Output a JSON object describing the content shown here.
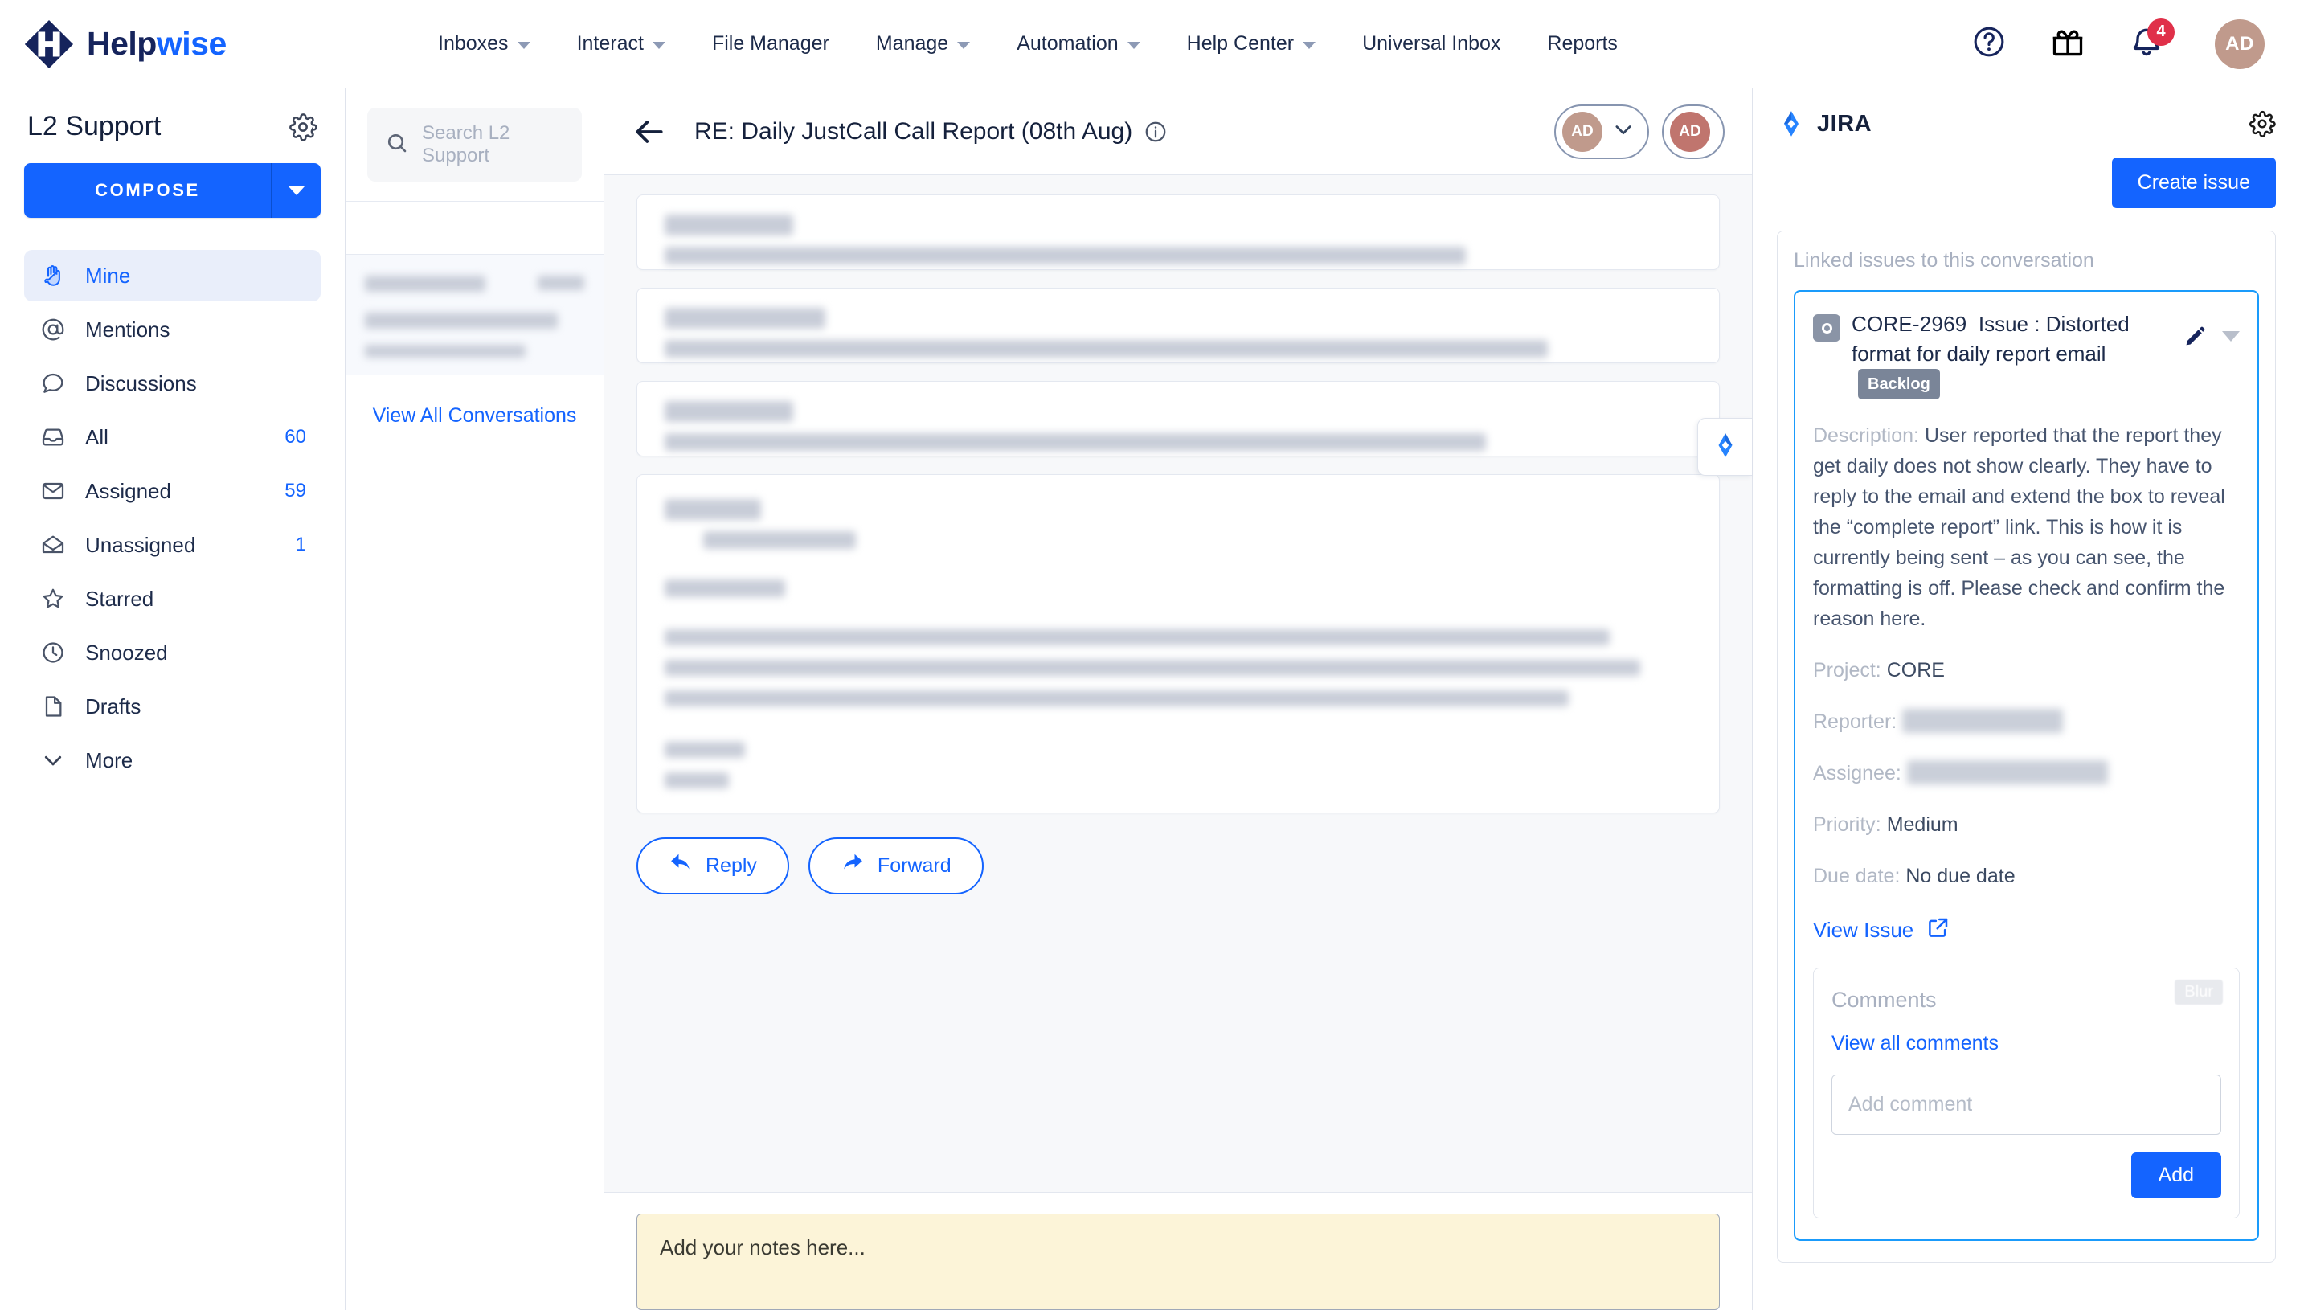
{
  "brand": {
    "name_primary": "Help",
    "name_secondary": "wise",
    "logo_icon": "helpwise-diamond-logo"
  },
  "topnav": {
    "items": [
      {
        "label": "Inboxes",
        "has_caret": true
      },
      {
        "label": "Interact",
        "has_caret": true
      },
      {
        "label": "File Manager",
        "has_caret": false
      },
      {
        "label": "Manage",
        "has_caret": true
      },
      {
        "label": "Automation",
        "has_caret": true
      },
      {
        "label": "Help Center",
        "has_caret": true
      },
      {
        "label": "Universal Inbox",
        "has_caret": false
      },
      {
        "label": "Reports",
        "has_caret": false
      }
    ],
    "help_icon": "question-circle-icon",
    "gift_icon": "gift-icon",
    "bell_icon": "bell-icon",
    "notification_count": "4",
    "avatar_initials": "AD"
  },
  "sidebar": {
    "title": "L2 Support",
    "settings_icon": "gear-icon",
    "compose_label": "COMPOSE",
    "items": [
      {
        "label": "Mine",
        "count": "",
        "icon": "hand-icon",
        "active": true
      },
      {
        "label": "Mentions",
        "count": "",
        "icon": "at-sign-icon",
        "active": false
      },
      {
        "label": "Discussions",
        "count": "",
        "icon": "chat-bubble-icon",
        "active": false
      },
      {
        "label": "All",
        "count": "60",
        "icon": "inbox-icon",
        "active": false
      },
      {
        "label": "Assigned",
        "count": "59",
        "icon": "envelope-closed-icon",
        "active": false
      },
      {
        "label": "Unassigned",
        "count": "1",
        "icon": "envelope-open-icon",
        "active": false
      },
      {
        "label": "Starred",
        "count": "",
        "icon": "star-icon",
        "active": false
      },
      {
        "label": "Snoozed",
        "count": "",
        "icon": "clock-icon",
        "active": false
      },
      {
        "label": "Drafts",
        "count": "",
        "icon": "document-icon",
        "active": false
      },
      {
        "label": "More",
        "count": "",
        "icon": "chevron-down-icon",
        "active": false
      }
    ]
  },
  "conversation_list": {
    "search_placeholder": "Search L2 Support",
    "search_icon": "search-icon",
    "view_all_label": "View All Conversations"
  },
  "thread": {
    "back_icon": "back-arrow-icon",
    "title": "RE: Daily JustCall Call Report (08th Aug)",
    "info_icon": "info-circle-icon",
    "assignee_initials": "AD",
    "assignee2_initials": "AD",
    "jira_tab_icon": "jira-diamond-icon",
    "reply_label": "Reply",
    "reply_icon": "reply-arrow-icon",
    "forward_label": "Forward",
    "forward_icon": "forward-arrow-icon",
    "notes_placeholder": "Add your notes here..."
  },
  "jira": {
    "panel_title": "JIRA",
    "logo_icon": "jira-diamond-icon",
    "settings_icon": "gear-icon",
    "create_issue_label": "Create issue",
    "linked_label": "Linked issues to this conversation",
    "issue": {
      "type_icon": "issue-type-icon",
      "key": "CORE-2969",
      "summary_prefix": "Issue : ",
      "summary": "Distorted format for daily report email",
      "status_badge": "Backlog",
      "edit_icon": "pencil-icon",
      "expand_icon": "caret-down-icon",
      "description_label": "Description:",
      "description": "User reported that the report they get daily does not show clearly. They have to reply to the email and extend the box to reveal the “complete report” link. This is how it is currently being sent – as you can see, the formatting is off. Please check and confirm the reason here.",
      "project_label": "Project:",
      "project_value": "CORE",
      "reporter_label": "Reporter:",
      "reporter_value": "",
      "assignee_label": "Assignee:",
      "assignee_value": "",
      "priority_label": "Priority:",
      "priority_value": "Medium",
      "due_date_label": "Due date:",
      "due_date_value": "No due date",
      "view_issue_label": "View Issue",
      "view_issue_icon": "external-link-icon"
    },
    "comments": {
      "heading": "Comments",
      "blur_tag": "Blur",
      "view_all_label": "View all comments",
      "input_placeholder": "Add comment",
      "add_label": "Add"
    }
  },
  "colors": {
    "accent_blue": "#1464ff",
    "brand_navy": "#16245c",
    "badge_red": "#e03049",
    "avatar_tan": "#c09a8c",
    "notes_yellow": "#fcf4d8",
    "jira_blue": "#2684ff"
  }
}
